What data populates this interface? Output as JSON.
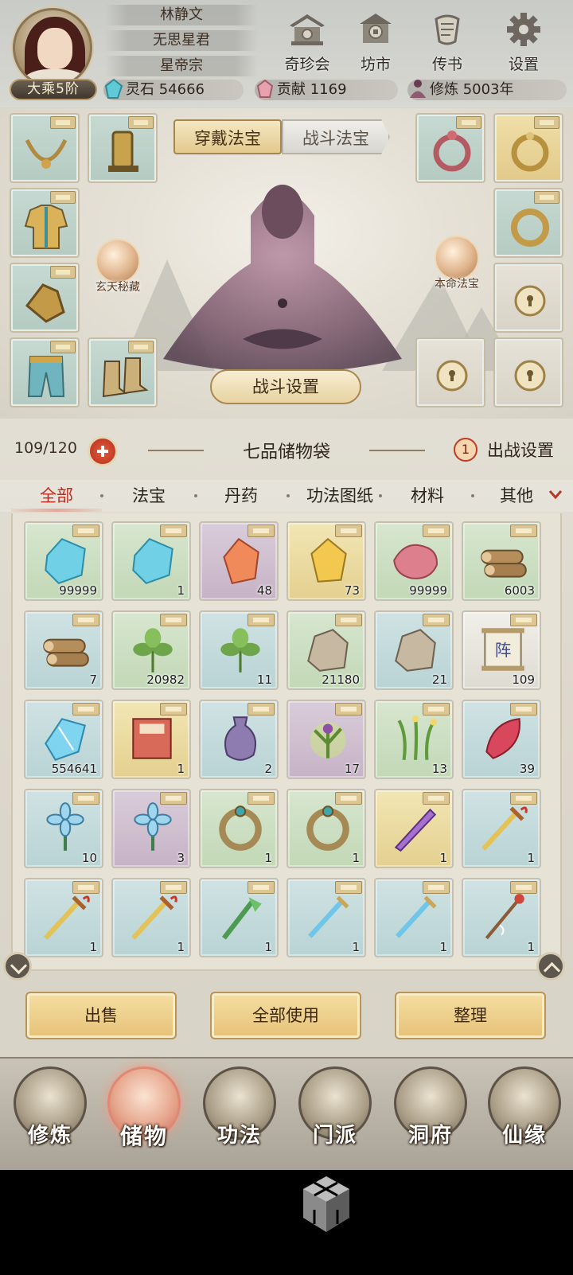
{
  "header": {
    "player_name": "林静文",
    "title": "无思星君",
    "sect": "星帝宗",
    "rank": "大乘5阶",
    "buttons": [
      {
        "label": "奇珍会",
        "icon": "pavilion-icon"
      },
      {
        "label": "坊市",
        "icon": "market-icon"
      },
      {
        "label": "传书",
        "icon": "scroll-letter-icon"
      },
      {
        "label": "设置",
        "icon": "gear-icon"
      }
    ],
    "resources": {
      "spirit_stone_label": "灵石",
      "spirit_stone_value": "54666",
      "contribution_label": "贡献",
      "contribution_value": "1169",
      "cultivation_label": "修炼",
      "cultivation_value": "5003年"
    }
  },
  "equip": {
    "tab_active": "穿戴法宝",
    "tab_inactive": "战斗法宝",
    "left_orb": "玄天秘藏",
    "right_orb": "本命法宝",
    "battle_settings": "战斗设置"
  },
  "bag": {
    "capacity": "109/120",
    "title": "七品储物袋",
    "deploy_count": "1",
    "deploy_label": "出战设置"
  },
  "categories": [
    "全部",
    "法宝",
    "丹药",
    "功法图纸",
    "材料",
    "其他"
  ],
  "items": [
    {
      "icon": "blue-crystal-icon",
      "count": "99999",
      "bg": "bg-green"
    },
    {
      "icon": "blue-crystal-icon",
      "count": "1",
      "bg": "bg-green"
    },
    {
      "icon": "orange-ore-icon",
      "count": "48",
      "bg": "bg-purple"
    },
    {
      "icon": "yellow-ore-icon",
      "count": "73",
      "bg": "bg-gold"
    },
    {
      "icon": "pink-meat-icon",
      "count": "99999",
      "bg": "bg-green"
    },
    {
      "icon": "logs-icon",
      "count": "6003",
      "bg": "bg-green"
    },
    {
      "icon": "logs-icon",
      "count": "7",
      "bg": "bg-blue"
    },
    {
      "icon": "herb-icon",
      "count": "20982",
      "bg": "bg-green"
    },
    {
      "icon": "herb-icon",
      "count": "11",
      "bg": "bg-blue"
    },
    {
      "icon": "rock-icon",
      "count": "21180",
      "bg": "bg-green"
    },
    {
      "icon": "rock-icon",
      "count": "21",
      "bg": "bg-blue"
    },
    {
      "icon": "formation-scroll-icon",
      "count": "109",
      "bg": "bg-white"
    },
    {
      "icon": "ice-crystal-icon",
      "count": "554641",
      "bg": "bg-blue"
    },
    {
      "icon": "book-icon",
      "count": "1",
      "bg": "bg-gold"
    },
    {
      "icon": "vase-icon",
      "count": "2",
      "bg": "bg-blue"
    },
    {
      "icon": "glowing-herb-icon",
      "count": "17",
      "bg": "bg-purple"
    },
    {
      "icon": "spirit-grass-icon",
      "count": "13",
      "bg": "bg-green"
    },
    {
      "icon": "red-leaf-icon",
      "count": "39",
      "bg": "bg-blue"
    },
    {
      "icon": "blue-flower-icon",
      "count": "10",
      "bg": "bg-blue"
    },
    {
      "icon": "blue-flower-icon",
      "count": "3",
      "bg": "bg-purple"
    },
    {
      "icon": "ring-icon",
      "count": "1",
      "bg": "bg-green"
    },
    {
      "icon": "ring-icon",
      "count": "1",
      "bg": "bg-green"
    },
    {
      "icon": "purple-blade-icon",
      "count": "1",
      "bg": "bg-gold"
    },
    {
      "icon": "golden-sword-icon",
      "count": "1",
      "bg": "bg-blue"
    },
    {
      "icon": "golden-sword-icon",
      "count": "1",
      "bg": "bg-blue"
    },
    {
      "icon": "golden-sword-icon",
      "count": "1",
      "bg": "bg-blue"
    },
    {
      "icon": "green-spear-icon",
      "count": "1",
      "bg": "bg-blue"
    },
    {
      "icon": "blue-sword-icon",
      "count": "1",
      "bg": "bg-blue"
    },
    {
      "icon": "blue-sword-icon",
      "count": "1",
      "bg": "bg-blue"
    },
    {
      "icon": "red-staff-icon",
      "count": "1",
      "bg": "bg-blue"
    }
  ],
  "actions": [
    "出售",
    "全部使用",
    "整理"
  ],
  "nav": [
    {
      "label": "修炼",
      "icon": "meditation-icon",
      "active": false
    },
    {
      "label": "储物",
      "icon": "bag-icon",
      "active": true
    },
    {
      "label": "功法",
      "icon": "scroll-icon",
      "active": false
    },
    {
      "label": "门派",
      "icon": "gate-icon",
      "active": false
    },
    {
      "label": "洞府",
      "icon": "mountain-icon",
      "active": false
    },
    {
      "label": "仙缘",
      "icon": "cloud-icon",
      "active": false
    }
  ],
  "colors": {
    "accent_red": "#c3281c",
    "gold": "#e6c178",
    "panel": "#e7e2d6"
  }
}
